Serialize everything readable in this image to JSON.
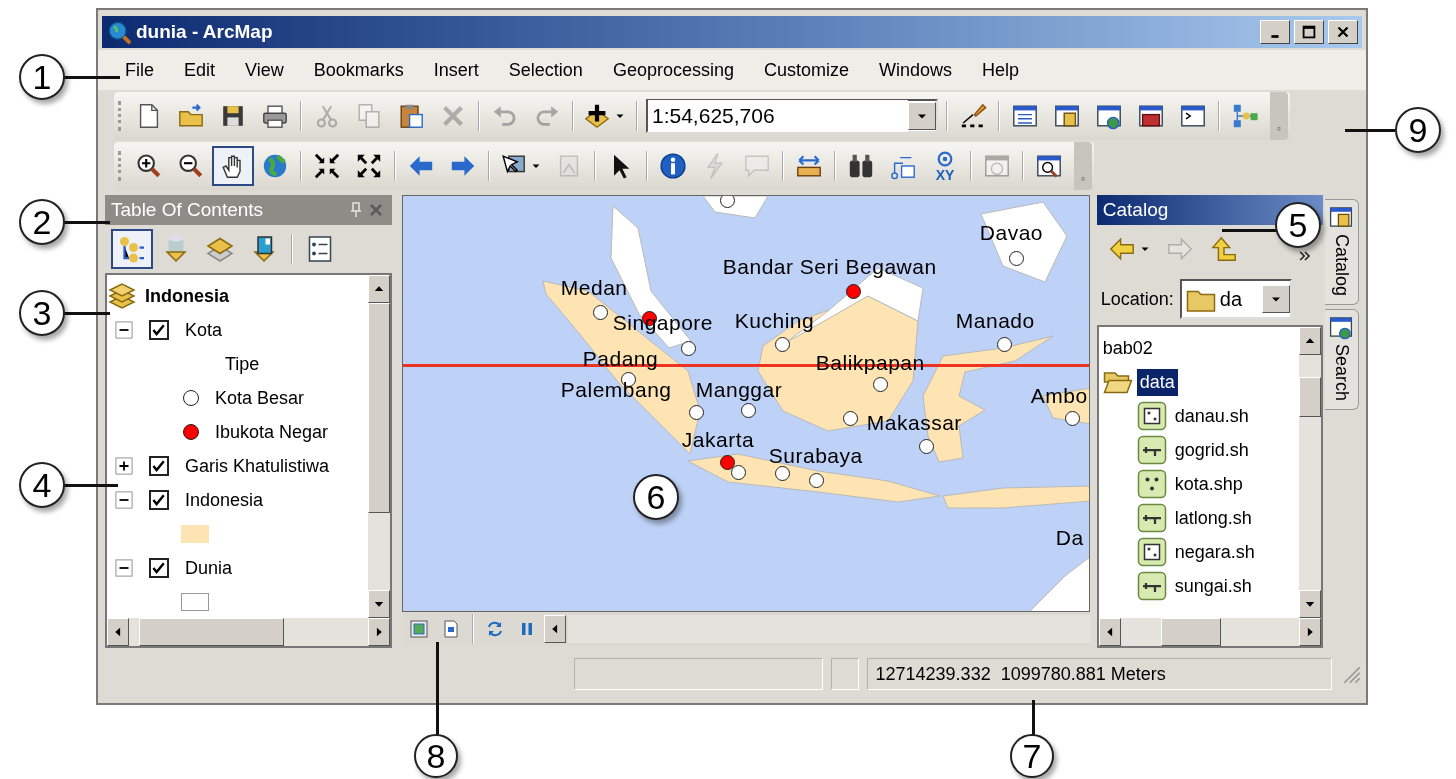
{
  "window": {
    "title": "dunia - ArcMap"
  },
  "menu": [
    {
      "label": "File"
    },
    {
      "label": "Edit"
    },
    {
      "label": "View"
    },
    {
      "label": "Bookmarks"
    },
    {
      "label": "Insert"
    },
    {
      "label": "Selection"
    },
    {
      "label": "Geoprocessing"
    },
    {
      "label": "Customize"
    },
    {
      "label": "Windows"
    },
    {
      "label": "Help"
    }
  ],
  "standard_toolbar": [
    {
      "kind": "button",
      "disabled": false,
      "pressed": false
    },
    {
      "kind": "button",
      "disabled": false,
      "pressed": false
    },
    {
      "kind": "button",
      "disabled": false,
      "pressed": false
    },
    {
      "kind": "button",
      "disabled": false,
      "pressed": false
    },
    {
      "kind": "separator"
    },
    {
      "kind": "button",
      "disabled": true,
      "pressed": false
    },
    {
      "kind": "button",
      "disabled": true,
      "pressed": false
    },
    {
      "kind": "button",
      "disabled": false,
      "pressed": false
    },
    {
      "kind": "button",
      "disabled": true,
      "pressed": false
    },
    {
      "kind": "separator"
    },
    {
      "kind": "button",
      "disabled": true,
      "pressed": false
    },
    {
      "kind": "button",
      "disabled": true,
      "pressed": false
    },
    {
      "kind": "separator"
    },
    {
      "kind": "dropdown",
      "disabled": false,
      "pressed": false
    },
    {
      "kind": "separator"
    },
    {
      "kind": "combo",
      "value": "1:54,625,706"
    },
    {
      "kind": "separator"
    },
    {
      "kind": "button",
      "disabled": false,
      "pressed": false
    },
    {
      "kind": "separator"
    },
    {
      "kind": "button",
      "disabled": false,
      "pressed": false
    },
    {
      "kind": "button",
      "disabled": false,
      "pressed": false
    },
    {
      "kind": "button",
      "disabled": false,
      "pressed": false
    },
    {
      "kind": "button",
      "disabled": false,
      "pressed": false
    },
    {
      "kind": "button",
      "disabled": false,
      "pressed": false
    },
    {
      "kind": "separator"
    },
    {
      "kind": "button",
      "disabled": false,
      "pressed": false
    }
  ],
  "tools_toolbar": [
    {
      "kind": "button",
      "disabled": false,
      "pressed": false
    },
    {
      "kind": "button",
      "disabled": false,
      "pressed": false
    },
    {
      "kind": "button",
      "disabled": false,
      "pressed": true
    },
    {
      "kind": "button",
      "disabled": false,
      "pressed": false
    },
    {
      "kind": "separator"
    },
    {
      "kind": "button",
      "disabled": false,
      "pressed": false
    },
    {
      "kind": "button",
      "disabled": false,
      "pressed": false
    },
    {
      "kind": "separator"
    },
    {
      "kind": "button",
      "disabled": false,
      "pressed": false
    },
    {
      "kind": "button",
      "disabled": false,
      "pressed": false
    },
    {
      "kind": "separator"
    },
    {
      "kind": "dropdown",
      "disabled": false,
      "pressed": false
    },
    {
      "kind": "button",
      "disabled": true,
      "pressed": false
    },
    {
      "kind": "separator"
    },
    {
      "kind": "button",
      "disabled": false,
      "pressed": false
    },
    {
      "kind": "separator"
    },
    {
      "kind": "button",
      "disabled": false,
      "pressed": false
    },
    {
      "kind": "button",
      "disabled": true,
      "pressed": false
    },
    {
      "kind": "button",
      "disabled": true,
      "pressed": false
    },
    {
      "kind": "separator"
    },
    {
      "kind": "button",
      "disabled": false,
      "pressed": false
    },
    {
      "kind": "separator"
    },
    {
      "kind": "button",
      "disabled": false,
      "pressed": false
    },
    {
      "kind": "button",
      "disabled": false,
      "pressed": false
    },
    {
      "kind": "button",
      "disabled": false,
      "pressed": false,
      "label": "XY"
    },
    {
      "kind": "separator"
    },
    {
      "kind": "button",
      "disabled": true,
      "pressed": false
    },
    {
      "kind": "separator"
    },
    {
      "kind": "button",
      "disabled": false,
      "pressed": false
    }
  ],
  "table_of_contents": {
    "title": "Table Of Contents",
    "toolbar": [
      {
        "kind": "button",
        "pressed": true
      },
      {
        "kind": "button",
        "pressed": false
      },
      {
        "kind": "button",
        "pressed": false
      },
      {
        "kind": "button",
        "pressed": false
      },
      {
        "kind": "separator"
      },
      {
        "kind": "button",
        "pressed": false
      }
    ],
    "tree": {
      "label": "Indonesia",
      "children": [
        {
          "label": "Kota",
          "checked": true,
          "expanded": true,
          "legend": [
            {
              "kind": "heading",
              "label": "Tipe"
            },
            {
              "kind": "symbol",
              "label": "Kota Besar",
              "color": "#ffffff"
            },
            {
              "kind": "symbol",
              "label": "Ibukota Negar",
              "color": "#ff0000"
            }
          ]
        },
        {
          "label": "Garis Khatulistiwa",
          "checked": true,
          "expanded": false
        },
        {
          "label": "Indonesia",
          "checked": true,
          "expanded": true,
          "legend": [
            {
              "kind": "fill",
              "color": "#fde4b2"
            }
          ]
        },
        {
          "label": "Dunia",
          "checked": true,
          "expanded": true,
          "legend": [
            {
              "kind": "fill",
              "color": "#ffffff"
            }
          ]
        }
      ]
    }
  },
  "map": {
    "cities": [
      {
        "label": "Davao",
        "capital": false
      },
      {
        "label": "Bandar Seri Begawan",
        "capital": true
      },
      {
        "label": "Medan",
        "capital": false
      },
      {
        "label": "Singapore",
        "capital": true
      },
      {
        "label": "Kuching",
        "capital": false
      },
      {
        "label": "Manado",
        "capital": false
      },
      {
        "label": "Padang",
        "capital": false
      },
      {
        "label": "Balikpapan",
        "capital": false
      },
      {
        "label": "Palembang",
        "capital": false
      },
      {
        "label": "Manggar",
        "capital": false
      },
      {
        "label": "Ambo",
        "capital": false
      },
      {
        "label": "Makassar",
        "capital": false
      },
      {
        "label": "Jakarta",
        "capital": true
      },
      {
        "label": "Surabaya",
        "capital": false
      },
      {
        "label": "Da"
      }
    ]
  },
  "catalog": {
    "title": "Catalog",
    "toolbar": [
      {
        "kind": "dropdown",
        "disabled": false
      },
      {
        "kind": "button",
        "disabled": true
      },
      {
        "kind": "button",
        "disabled": false
      },
      {
        "kind": "overflow"
      }
    ],
    "location": {
      "label": "Location:",
      "value": "da"
    },
    "tree": [
      {
        "label": "bab02",
        "selected": false
      },
      {
        "label": "data",
        "selected": true,
        "expanded": true,
        "children": [
          {
            "label": "danau.sh",
            "kind": "polygon",
            "selected": false
          },
          {
            "label": "gogrid.sh",
            "kind": "line",
            "selected": false
          },
          {
            "label": "kota.shp",
            "kind": "point",
            "selected": false
          },
          {
            "label": "latlong.sh",
            "kind": "line",
            "selected": false
          },
          {
            "label": "negara.sh",
            "kind": "polygon",
            "selected": false
          },
          {
            "label": "sungai.sh",
            "kind": "line",
            "selected": false
          }
        ]
      }
    ]
  },
  "side_tabs": [
    {
      "label": "Catalog"
    },
    {
      "label": "Search"
    }
  ],
  "status_bar": {
    "coordinates": "12714239.332  1099780.881 Meters"
  },
  "callouts": [
    {
      "number": "1"
    },
    {
      "number": "2"
    },
    {
      "number": "3"
    },
    {
      "number": "4"
    },
    {
      "number": "5"
    },
    {
      "number": "6"
    },
    {
      "number": "7"
    },
    {
      "number": "8"
    },
    {
      "number": "9"
    }
  ]
}
